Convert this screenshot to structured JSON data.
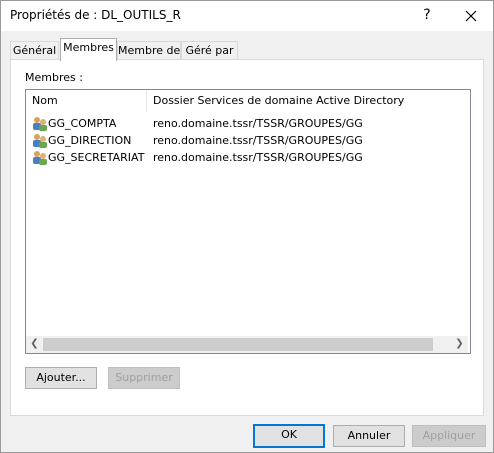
{
  "window": {
    "title": "Propriétés de : DL_OUTILS_R",
    "help_label": "?"
  },
  "tabs": [
    {
      "label": "Général"
    },
    {
      "label": "Membres"
    },
    {
      "label": "Membre de"
    },
    {
      "label": "Géré par"
    }
  ],
  "members": {
    "section_label": "Membres :",
    "columns": [
      "Nom",
      "Dossier Services de domaine Active Directory"
    ],
    "rows": [
      {
        "name": "GG_COMPTA",
        "folder": "reno.domaine.tssr/TSSR/GROUPES/GG"
      },
      {
        "name": "GG_DIRECTION",
        "folder": "reno.domaine.tssr/TSSR/GROUPES/GG"
      },
      {
        "name": "GG_SECRETARIAT",
        "folder": "reno.domaine.tssr/TSSR/GROUPES/GG"
      }
    ],
    "add_label": "Ajouter...",
    "remove_label": "Supprimer"
  },
  "footer": {
    "ok_label": "OK",
    "cancel_label": "Annuler",
    "apply_label": "Appliquer"
  },
  "colors": {
    "accent": "#0078d7"
  }
}
